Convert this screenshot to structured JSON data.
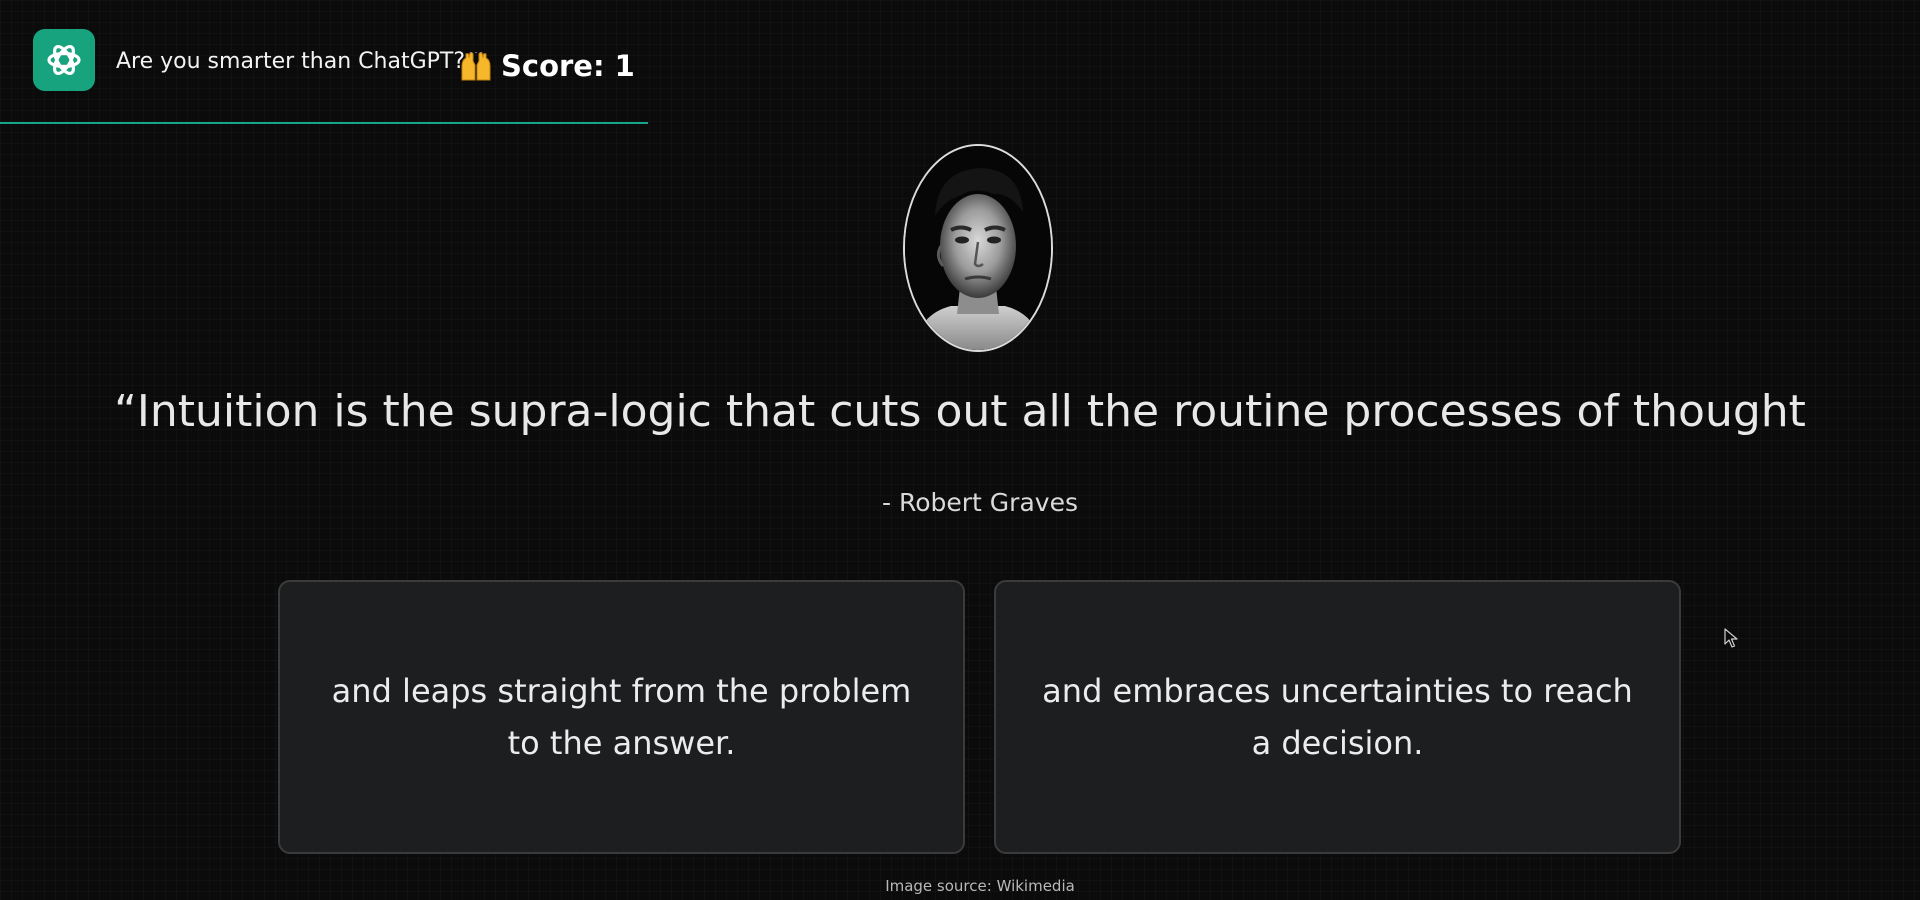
{
  "header": {
    "title": "Are you smarter than ChatGPT?",
    "score": "Score: 1"
  },
  "quote": {
    "text": "“Intuition is the supra-logic that cuts out all the routine processes of thought",
    "author": "- Robert Graves"
  },
  "options": [
    {
      "text": "and leaps straight from the problem to the answer."
    },
    {
      "text": "and embraces uncertainties to reach a decision."
    }
  ],
  "footer": {
    "source": "Image source: Wikimedia"
  },
  "icons": {
    "logo": "chatgpt-logo-icon",
    "emoji": "raising-hands-icon",
    "portrait": "author-portrait",
    "cursor": "mouse-cursor-icon"
  },
  "colors": {
    "background": "#0b0b0b",
    "accent": "#14a58a",
    "logo_bg": "#18a37f",
    "card_bg": "#1d1e20",
    "card_border": "#3b3b3b"
  }
}
